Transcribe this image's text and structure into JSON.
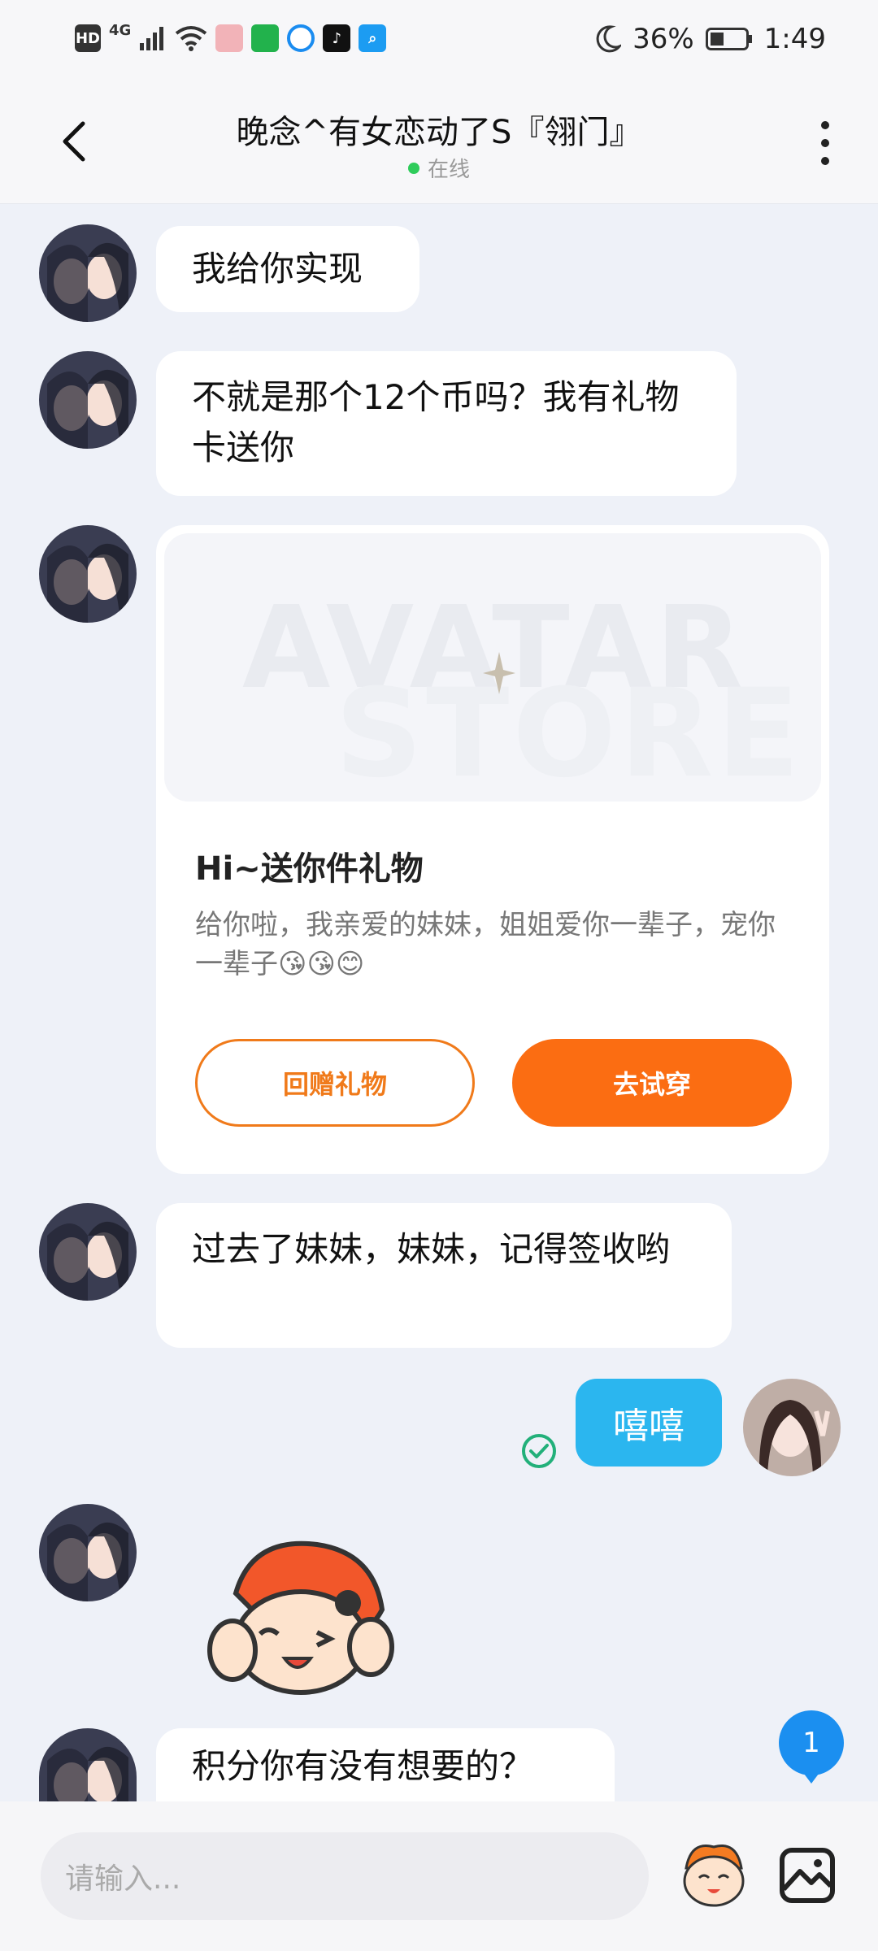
{
  "status_bar": {
    "hd": "HD",
    "network": "4G",
    "app_icons": [
      "news-app-icon",
      "iqiyi-app-icon",
      "browser-app-icon",
      "tiktok-app-icon",
      "search-app-icon"
    ],
    "battery": "36%",
    "time": "1:49"
  },
  "header": {
    "title": "晚念^有女恋动了S『翎门』",
    "status": "在线"
  },
  "messages": [
    {
      "from": "other",
      "text": "我给你实现"
    },
    {
      "from": "other",
      "text": "不就是那个12个币吗？我有礼物卡送你"
    },
    {
      "from": "other",
      "type": "gift_card"
    },
    {
      "from": "other",
      "text": "过去了妹妹，妹妹，记得签收哟"
    },
    {
      "from": "me",
      "text": "嘻嘻"
    },
    {
      "from": "other",
      "type": "sticker"
    },
    {
      "from": "other",
      "text": "积分你有没有想要的？"
    }
  ],
  "gift_card": {
    "watermark_line1": "AVATAR",
    "watermark_line2": "STORE",
    "title": "Hi~送你件礼物",
    "desc": "给你啦，我亲爱的妹妹，姐姐爱你一辈子，宠你一辈子😘😘😊",
    "return_gift": "回赠礼物",
    "try_on": "去试穿"
  },
  "unread_count": "1",
  "input": {
    "placeholder": "请输入..."
  },
  "colors": {
    "accent_orange": "#fb6d12",
    "my_bubble": "#2bb6ef",
    "online_dot": "#2fcc5b",
    "unread_badge": "#1b8ff0"
  }
}
